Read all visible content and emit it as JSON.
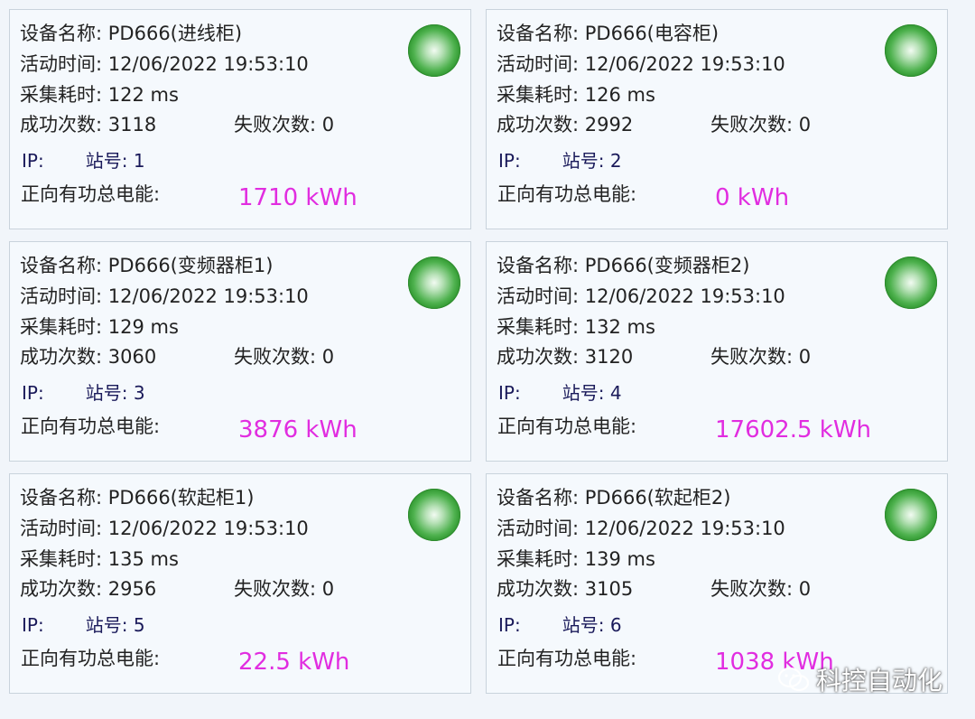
{
  "labels": {
    "device_name": "设备名称:",
    "active_time": "活动时间:",
    "collect_time": "采集耗时:",
    "success_count": "成功次数:",
    "fail_count": "失败次数:",
    "ip": "IP:",
    "station": "站号:",
    "energy": "正向有功总电能:"
  },
  "status_color": "#2e9e2e",
  "energy_color": "#e12de0",
  "devices": [
    {
      "name": "PD666(进线柜)",
      "time": "12/06/2022 19:53:10",
      "collect": "122 ms",
      "success": "3118",
      "fail": "0",
      "station": "1",
      "energy": "1710 kWh"
    },
    {
      "name": "PD666(电容柜)",
      "time": "12/06/2022 19:53:10",
      "collect": "126 ms",
      "success": "2992",
      "fail": "0",
      "station": "2",
      "energy": "0 kWh"
    },
    {
      "name": "PD666(变频器柜1)",
      "time": "12/06/2022 19:53:10",
      "collect": "129 ms",
      "success": "3060",
      "fail": "0",
      "station": "3",
      "energy": "3876 kWh"
    },
    {
      "name": "PD666(变频器柜2)",
      "time": "12/06/2022 19:53:10",
      "collect": "132 ms",
      "success": "3120",
      "fail": "0",
      "station": "4",
      "energy": "17602.5 kWh"
    },
    {
      "name": "PD666(软起柜1)",
      "time": "12/06/2022 19:53:10",
      "collect": "135 ms",
      "success": "2956",
      "fail": "0",
      "station": "5",
      "energy": "22.5 kWh"
    },
    {
      "name": "PD666(软起柜2)",
      "time": "12/06/2022 19:53:10",
      "collect": "139 ms",
      "success": "3105",
      "fail": "0",
      "station": "6",
      "energy": "1038 kWh"
    }
  ],
  "watermark": "科控自动化"
}
